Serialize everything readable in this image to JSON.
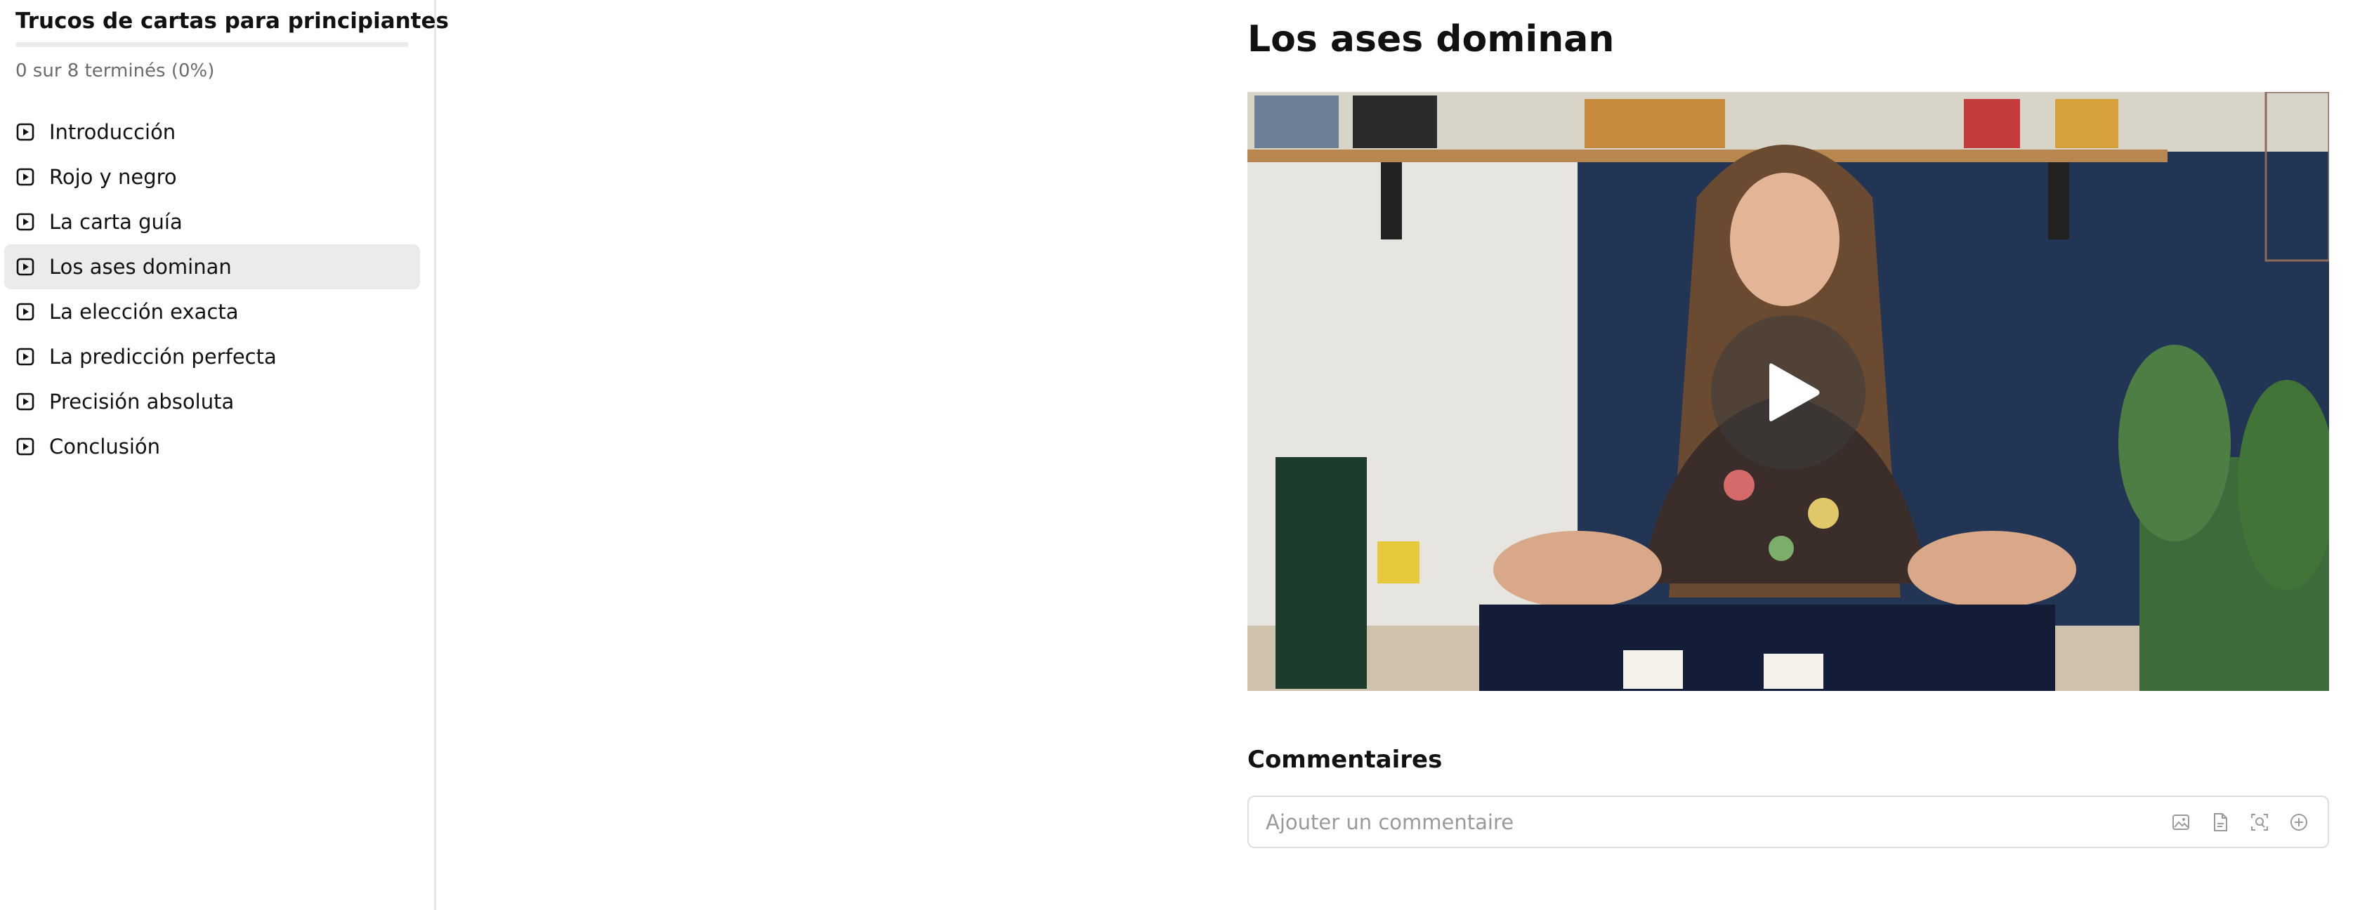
{
  "sidebar": {
    "course_title": "Trucos de cartas para principiantes",
    "progress_text": "0 sur 8 terminés (0%)",
    "progress_fraction": 0,
    "lessons": [
      {
        "label": "Introducción",
        "icon": "video-lesson-icon"
      },
      {
        "label": "Rojo y negro",
        "icon": "video-lesson-icon"
      },
      {
        "label": "La carta guía",
        "icon": "video-lesson-icon"
      },
      {
        "label": "Los ases dominan",
        "icon": "video-lesson-icon",
        "active": true
      },
      {
        "label": "La elección exacta",
        "icon": "video-lesson-icon"
      },
      {
        "label": "La predicción perfecta",
        "icon": "video-lesson-icon"
      },
      {
        "label": "Precisión absoluta",
        "icon": "video-lesson-icon"
      },
      {
        "label": "Conclusión",
        "icon": "video-lesson-icon"
      }
    ]
  },
  "main": {
    "lesson_title": "Los ases dominan",
    "video": {
      "play_icon": "play-icon"
    },
    "comments": {
      "heading": "Commentaires",
      "placeholder": "Ajouter un commentaire",
      "tools": [
        "image-icon",
        "file-icon",
        "gif-icon",
        "plus-circle-icon"
      ]
    }
  },
  "colors": {
    "active_item_bg": "#ebebeb",
    "progress_track": "#ececec",
    "text_primary": "#111111",
    "text_muted": "#6b6b6b"
  }
}
